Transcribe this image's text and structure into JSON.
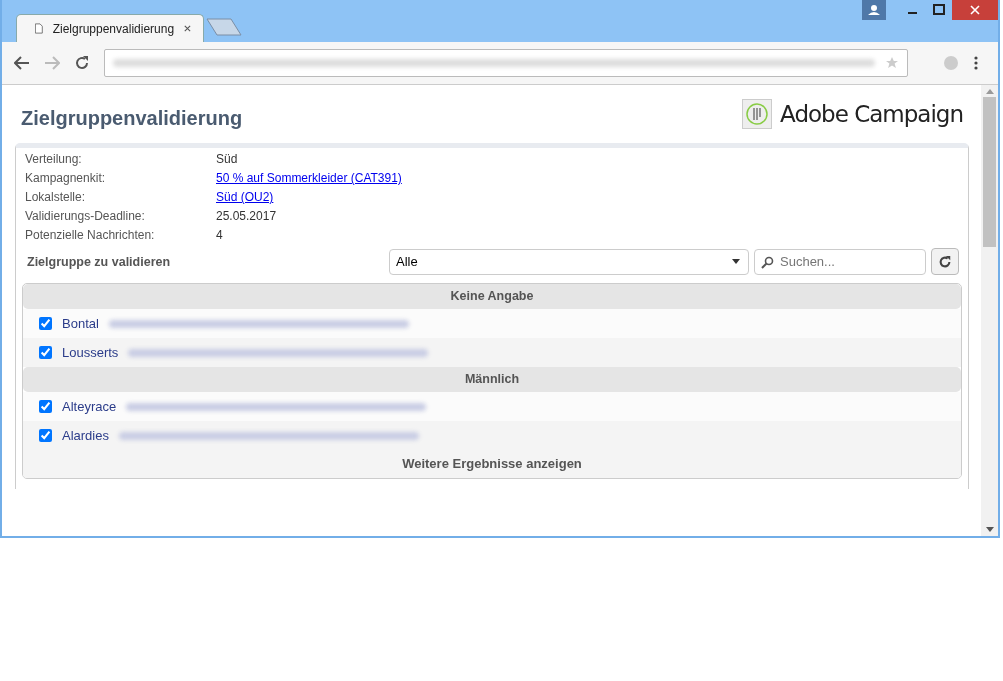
{
  "browser": {
    "tab_title": "Zielgruppenvalidierung"
  },
  "page": {
    "title": "Zielgruppenvalidierung",
    "logo_text": "Adobe Campaign"
  },
  "details": [
    {
      "label": "Verteilung:",
      "value": "Süd",
      "kind": "text"
    },
    {
      "label": "Kampagnenkit:",
      "value": "50 % auf Sommerkleider (CAT391)",
      "kind": "link"
    },
    {
      "label": "Lokalstelle:",
      "value": "Süd (OU2)",
      "kind": "link"
    },
    {
      "label": "Validierungs-Deadline:",
      "value": "25.05.2017",
      "kind": "text"
    },
    {
      "label": "Potenzielle Nachrichten:",
      "value": "4",
      "kind": "text"
    }
  ],
  "filter": {
    "label": "Zielgruppe zu validieren",
    "select_value": "Alle",
    "search_placeholder": "Suchen..."
  },
  "groups": [
    {
      "title": "Keine Angabe",
      "rows": [
        {
          "name": "Bontal",
          "checked": true
        },
        {
          "name": "Lousserts",
          "checked": true
        }
      ]
    },
    {
      "title": "Männlich",
      "rows": [
        {
          "name": "Alteyrace",
          "checked": true
        },
        {
          "name": "Alardies",
          "checked": true
        }
      ]
    }
  ],
  "more_results": "Weitere Ergebnisse anzeigen"
}
